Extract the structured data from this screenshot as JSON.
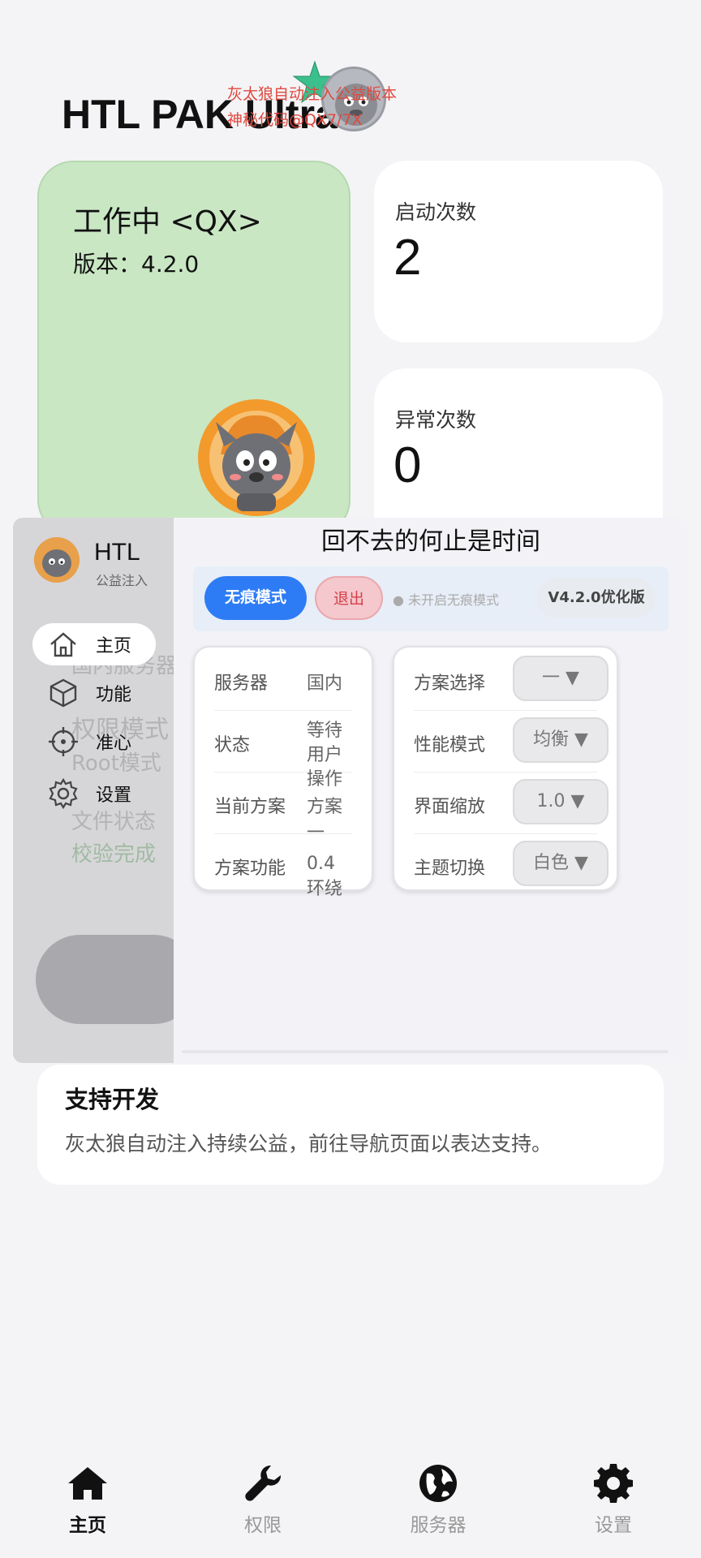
{
  "header": {
    "title": "HTL PAK Ultra",
    "watermark_line1": "灰太狼自动注入公益版本",
    "watermark_line2": "神秘代码@QX7/7X"
  },
  "status_card": {
    "title": "工作中 <QX>",
    "version": "版本：4.2.0"
  },
  "stats": [
    {
      "label": "启动次数",
      "value": "2"
    },
    {
      "label": "异常次数",
      "value": "0"
    }
  ],
  "overlay": {
    "brand": "HTL",
    "brand_sub": "公益注入",
    "ghost_text": [
      "国内服务器",
      "权限模式",
      "Root模式",
      "文件状态",
      "校验完成"
    ],
    "nav": [
      {
        "label": "主页",
        "icon": "home-icon",
        "active": true
      },
      {
        "label": "功能",
        "icon": "cube-icon",
        "active": false
      },
      {
        "label": "准心",
        "icon": "crosshair-icon",
        "active": false
      },
      {
        "label": "设置",
        "icon": "gear-icon",
        "active": false
      }
    ],
    "title": "回不去的何止是时间",
    "stealth_button": "无痕模式",
    "exit_button": "退出",
    "stealth_status": "● 未开启无痕模式",
    "version_badge": "V4.2.0优化版",
    "info": [
      {
        "key": "服务器",
        "value": "国内"
      },
      {
        "key": "状态",
        "value": "等待用户操作"
      },
      {
        "key": "当前方案",
        "value": "方案一"
      },
      {
        "key": "方案功能",
        "value": "0.4环绕"
      }
    ],
    "settings": [
      {
        "label": "方案选择",
        "value": "一 ▼"
      },
      {
        "label": "性能模式",
        "value": "均衡 ▼"
      },
      {
        "label": "界面缩放",
        "value": "1.0 ▼"
      },
      {
        "label": "主题切换",
        "value": "白色 ▼"
      }
    ]
  },
  "support": {
    "title": "支持开发",
    "text": "灰太狼自动注入持续公益，前往导航页面以表达支持。"
  },
  "bottom_nav": [
    {
      "label": "主页",
      "icon": "home-icon",
      "active": true
    },
    {
      "label": "权限",
      "icon": "wrench-icon",
      "active": false
    },
    {
      "label": "服务器",
      "icon": "globe-icon",
      "active": false
    },
    {
      "label": "设置",
      "icon": "gear-icon",
      "active": false
    }
  ],
  "colors": {
    "accent_blue": "#2d7cf6",
    "status_green": "#c9e7c3",
    "exit_red": "#d6404b"
  }
}
